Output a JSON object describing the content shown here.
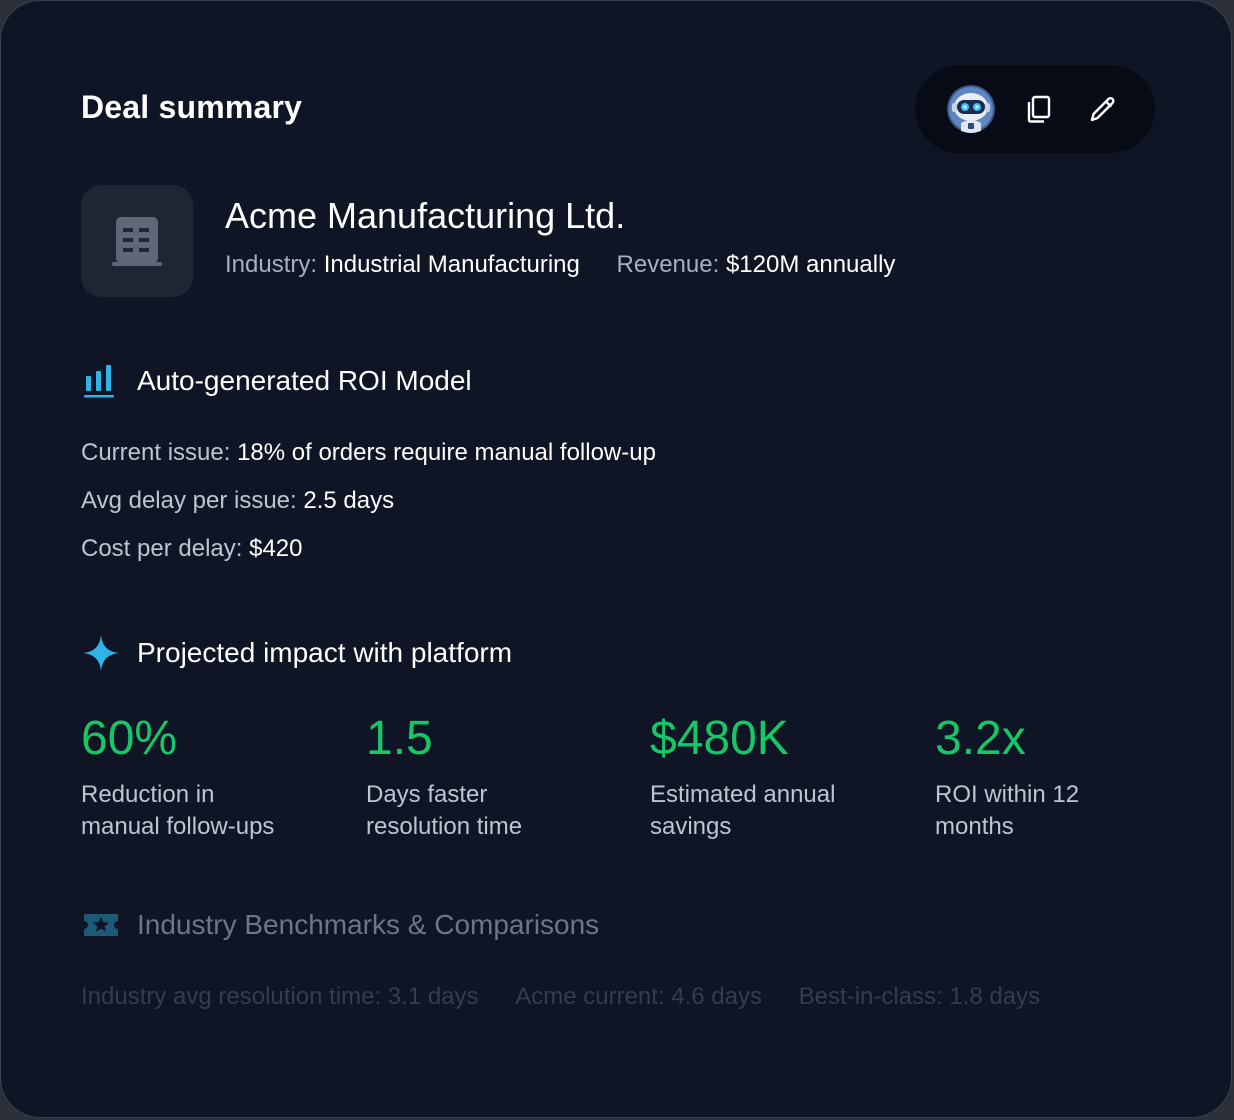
{
  "header": {
    "title": "Deal summary",
    "toolbar": {
      "avatar_icon": "robot-avatar",
      "copy_icon": "copy-icon",
      "edit_icon": "pencil-icon"
    }
  },
  "company": {
    "logo_icon": "building-icon",
    "name": "Acme Manufacturing Ltd.",
    "industry_label": "Industry:",
    "industry_value": "Industrial Manufacturing",
    "revenue_label": "Revenue:",
    "revenue_value": "$120M annually"
  },
  "roi_model": {
    "icon": "bar-chart-icon",
    "title": "Auto-generated ROI Model",
    "lines": [
      {
        "label": "Current issue:",
        "value": "18% of orders require manual follow-up"
      },
      {
        "label": "Avg delay per issue:",
        "value": "2.5 days"
      },
      {
        "label": "Cost per delay:",
        "value": "$420"
      }
    ]
  },
  "impact": {
    "icon": "sparkle-icon",
    "title": "Projected impact with platform",
    "stats": [
      {
        "value": "60%",
        "line1": "Reduction in",
        "line2": "manual follow-ups"
      },
      {
        "value": "1.5",
        "line1": "Days faster",
        "line2": "resolution time"
      },
      {
        "value": "$480K",
        "line1": "Estimated annual",
        "line2": "savings"
      },
      {
        "value": "3.2x",
        "line1": "ROI within 12",
        "line2": "months"
      }
    ]
  },
  "benchmarks": {
    "icon": "ticket-star-icon",
    "title": "Industry Benchmarks & Comparisons",
    "items": [
      "Industry avg resolution time: 3.1 days",
      "Acme current: 4.6 days",
      "Best-in-class: 1.8 days"
    ]
  },
  "colors": {
    "background": "#0f1524",
    "accent_green": "#16c768",
    "accent_blue": "#2fb4e8"
  }
}
